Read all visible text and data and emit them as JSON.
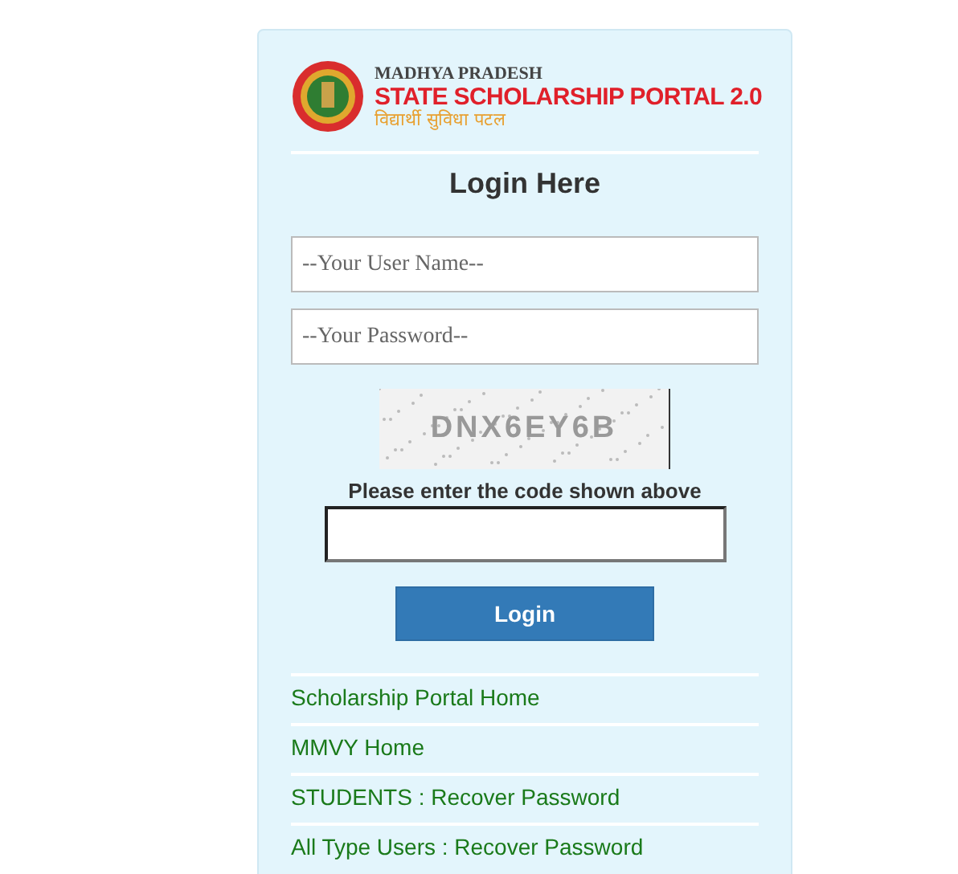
{
  "logo": {
    "line_1": "MADHYA PRADESH",
    "line_2": "STATE SCHOLARSHIP PORTAL 2.0",
    "line_3": "विद्यार्थी सुविधा पटल"
  },
  "heading": "Login Here",
  "username": {
    "placeholder": "--Your User Name--"
  },
  "password": {
    "placeholder": "--Your Password--"
  },
  "captcha": {
    "code": "DNX6EY6B",
    "label": "Please enter the code shown above"
  },
  "login_button": "Login",
  "links": [
    "Scholarship Portal Home",
    "MMVY Home",
    "STUDENTS : Recover Password",
    "All Type Users : Recover Password"
  ]
}
